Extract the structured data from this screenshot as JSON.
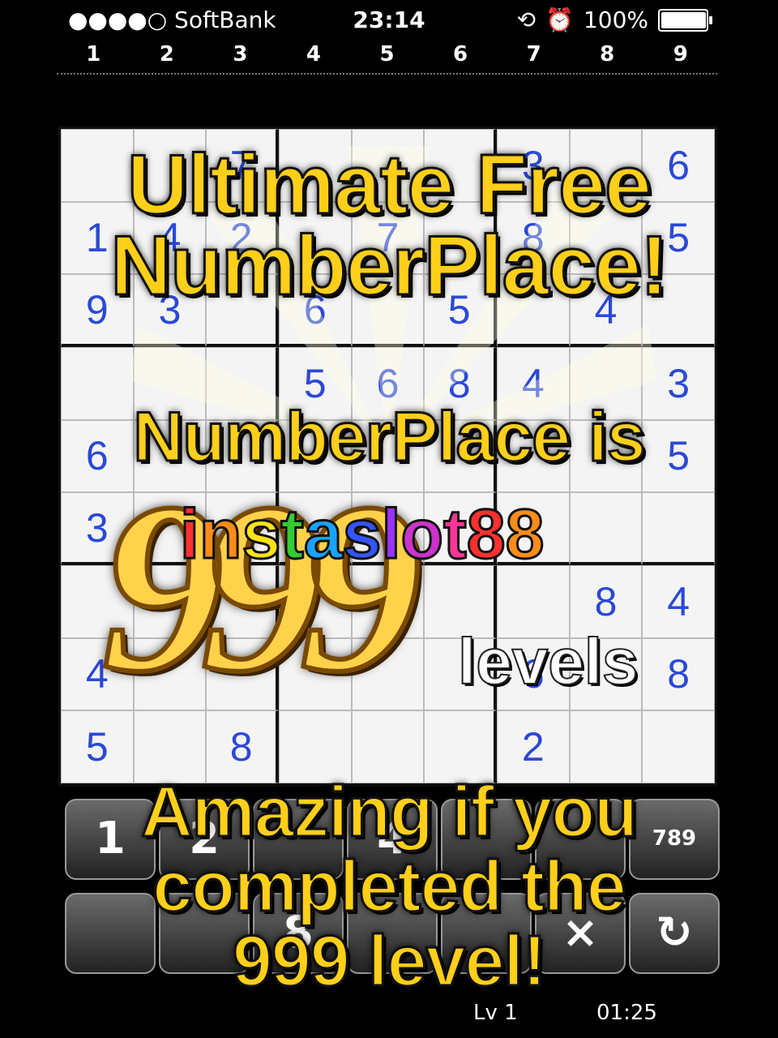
{
  "status_bar": {
    "carrier": "●●●●○ SoftBank",
    "time": "23:14",
    "battery": "100%",
    "battery_level": 1.0
  },
  "column_numbers": [
    "1",
    "2",
    "3",
    "4",
    "5",
    "6",
    "7",
    "8",
    "9"
  ],
  "board": {
    "rows": [
      [
        "",
        "",
        "7",
        "",
        "",
        "",
        "3",
        "",
        "6"
      ],
      [
        "1",
        "4",
        "2",
        "",
        "7",
        "",
        "8",
        "",
        "5"
      ],
      [
        "9",
        "3",
        "",
        "6",
        "",
        "5",
        "",
        "4",
        ""
      ],
      [
        "",
        "",
        "",
        "5",
        "6",
        "8",
        "4",
        "",
        "3"
      ],
      [
        "6",
        "",
        "",
        "",
        "",
        "",
        "",
        "",
        "5"
      ],
      [
        "3",
        "",
        "",
        "",
        "",
        "",
        "",
        "",
        ""
      ],
      [
        "",
        "",
        "",
        "",
        "",
        "",
        "",
        "8",
        "4"
      ],
      [
        "4",
        "",
        "",
        "",
        "",
        "",
        "6",
        "",
        "8"
      ],
      [
        "5",
        "",
        "8",
        "",
        "",
        "",
        "2",
        "",
        ""
      ]
    ]
  },
  "keypad": {
    "keys_row1": [
      "1",
      "2",
      "",
      "4",
      "",
      "",
      "789"
    ],
    "keys_row2": [
      "",
      "",
      "8",
      "",
      "",
      "×",
      "↻"
    ]
  },
  "footer": {
    "level": "Lv 1",
    "timer": "01:25"
  },
  "promo": {
    "headline_1a": "Ultimate Free",
    "headline_1b": "NumberPlace!",
    "headline_2": "NumberPlace is",
    "big_number": "999",
    "levels_word": "levels",
    "headline_3a": "Amazing if you",
    "headline_3b": "completed the",
    "headline_3c": "999 level!",
    "watermark": "instaslot88"
  },
  "colors": {
    "headline": "#ffcf1a",
    "given_digit": "#2b49d6",
    "board_bg": "#f4f4f4"
  }
}
